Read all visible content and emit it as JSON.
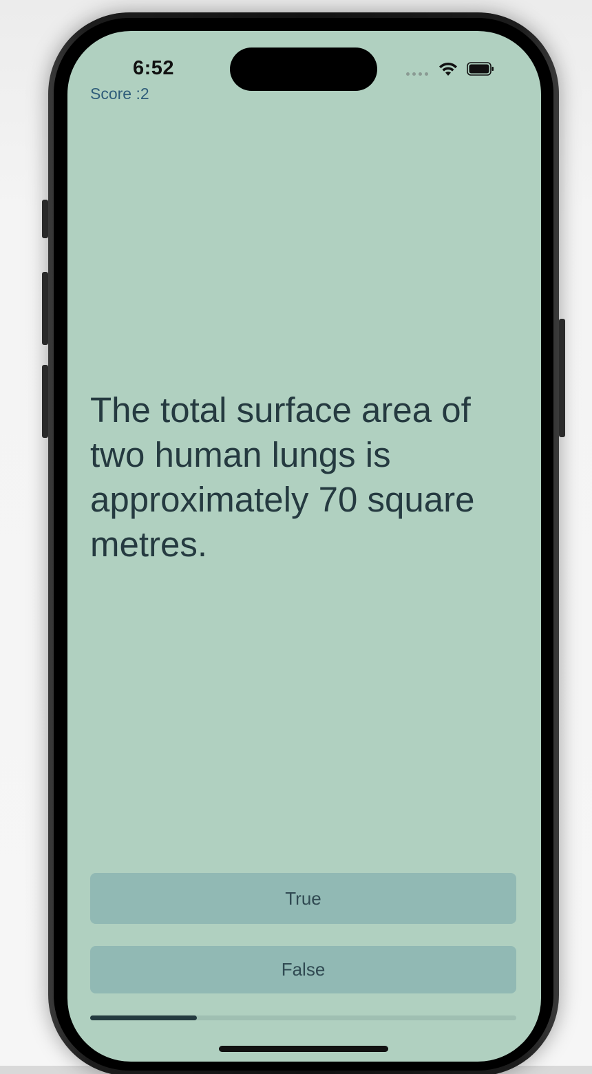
{
  "status_bar": {
    "time": "6:52",
    "icons": [
      "cellular-signal-icon",
      "wifi-icon",
      "battery-icon"
    ]
  },
  "score": {
    "label": "Score :2"
  },
  "question": {
    "text": "The total surface area of two human lungs is approximately 70 square metres."
  },
  "answers": {
    "true_label": "True",
    "false_label": "False"
  },
  "progress": {
    "fraction": 0.25
  },
  "colors": {
    "background": "#b0d0c0",
    "button": "#91b9b4",
    "text": "#253a40",
    "score_text": "#2f5d7a",
    "progress_fill": "#233a3f"
  }
}
